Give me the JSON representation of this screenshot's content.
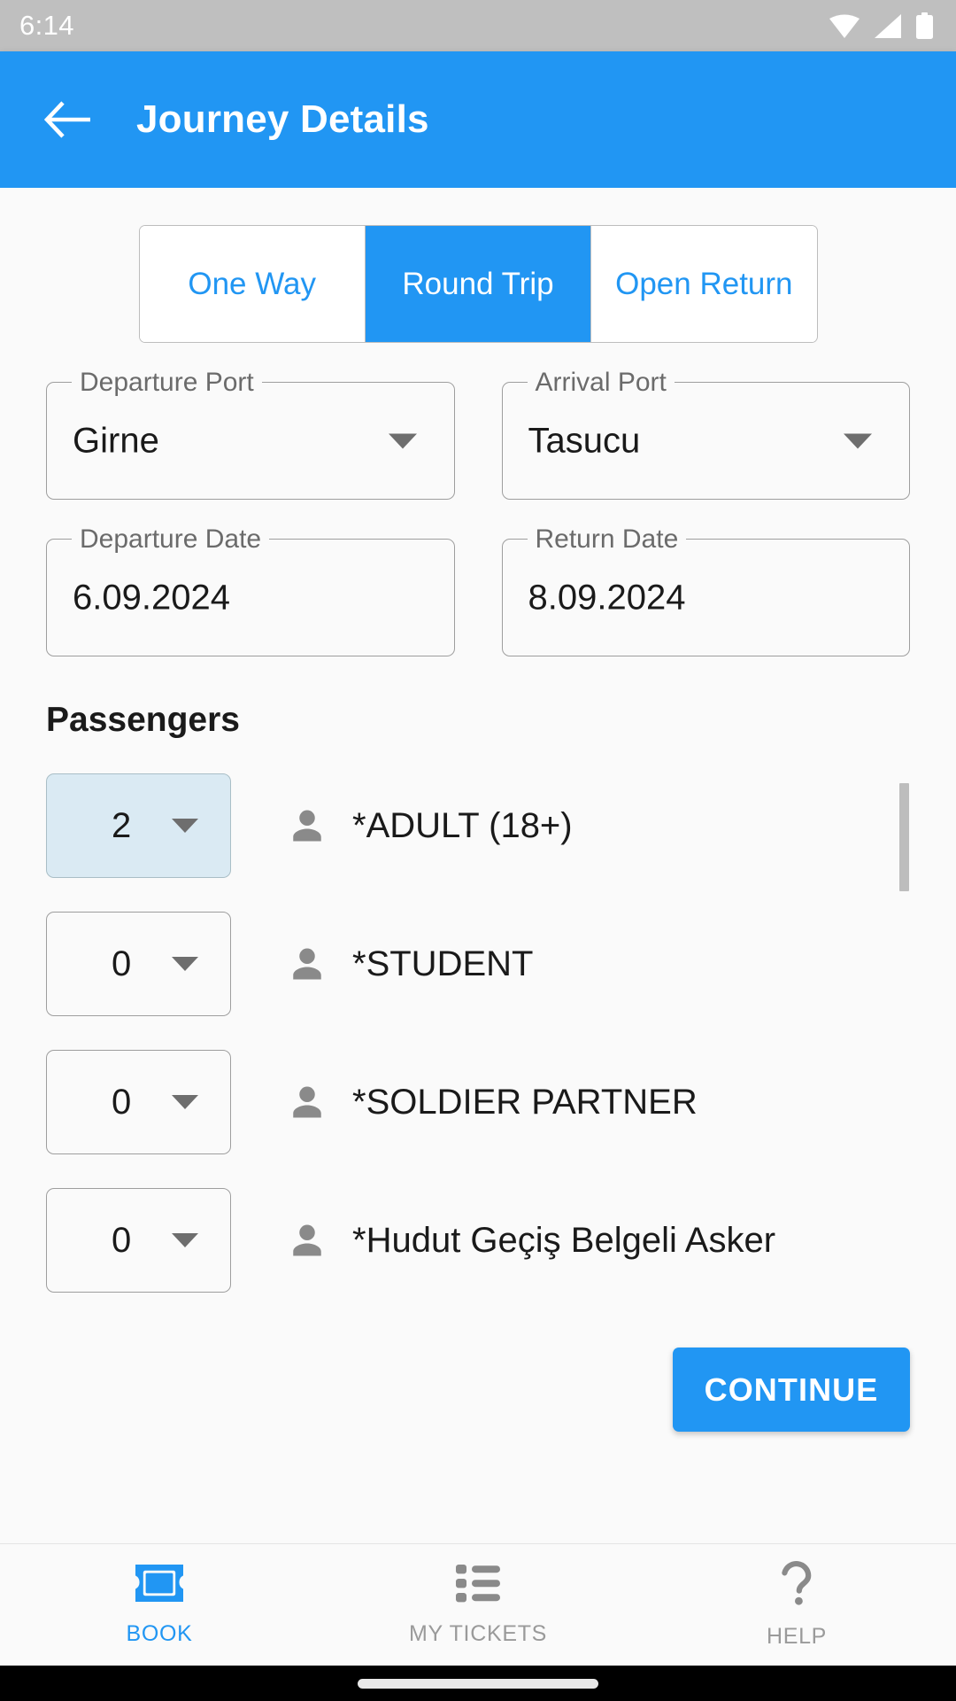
{
  "status_bar": {
    "time": "6:14",
    "icons": [
      "wifi-icon",
      "cell-signal-icon",
      "battery-icon"
    ]
  },
  "app_bar": {
    "title": "Journey Details",
    "back_icon": "back-arrow-icon",
    "background_color": "#2196F3"
  },
  "trip_type": {
    "options": [
      {
        "label": "One Way",
        "selected": false
      },
      {
        "label": "Round Trip",
        "selected": true
      },
      {
        "label": "Open Return",
        "selected": false
      }
    ],
    "accent_color": "#2196F3"
  },
  "journey_fields": [
    {
      "label": "Departure Port",
      "value": "Girne",
      "has_dropdown": true
    },
    {
      "label": "Arrival Port",
      "value": "Tasucu",
      "has_dropdown": true
    },
    {
      "label": "Departure Date",
      "value": "6.09.2024",
      "has_dropdown": false
    },
    {
      "label": "Return Date",
      "value": "8.09.2024",
      "has_dropdown": false
    }
  ],
  "passengers": {
    "heading": "Passengers",
    "rows": [
      {
        "count": "2",
        "label": "*ADULT (18+)",
        "highlighted": true,
        "icon": "person-icon"
      },
      {
        "count": "0",
        "label": "*STUDENT",
        "highlighted": false,
        "icon": "person-icon"
      },
      {
        "count": "0",
        "label": "*SOLDIER PARTNER",
        "highlighted": false,
        "icon": "person-icon"
      },
      {
        "count": "0",
        "label": "*Hudut Geçiş Belgeli Asker",
        "highlighted": false,
        "icon": "person-icon"
      }
    ],
    "highlight_color": "#DAEAF3"
  },
  "actions": {
    "continue_label": "CONTINUE"
  },
  "bottom_nav": {
    "items": [
      {
        "label": "BOOK",
        "icon": "ticket-icon",
        "active": true
      },
      {
        "label": "MY TICKETS",
        "icon": "list-icon",
        "active": false
      },
      {
        "label": "HELP",
        "icon": "question-icon",
        "active": false
      }
    ],
    "active_color": "#2196F3",
    "inactive_color": "#9A9A9A"
  }
}
